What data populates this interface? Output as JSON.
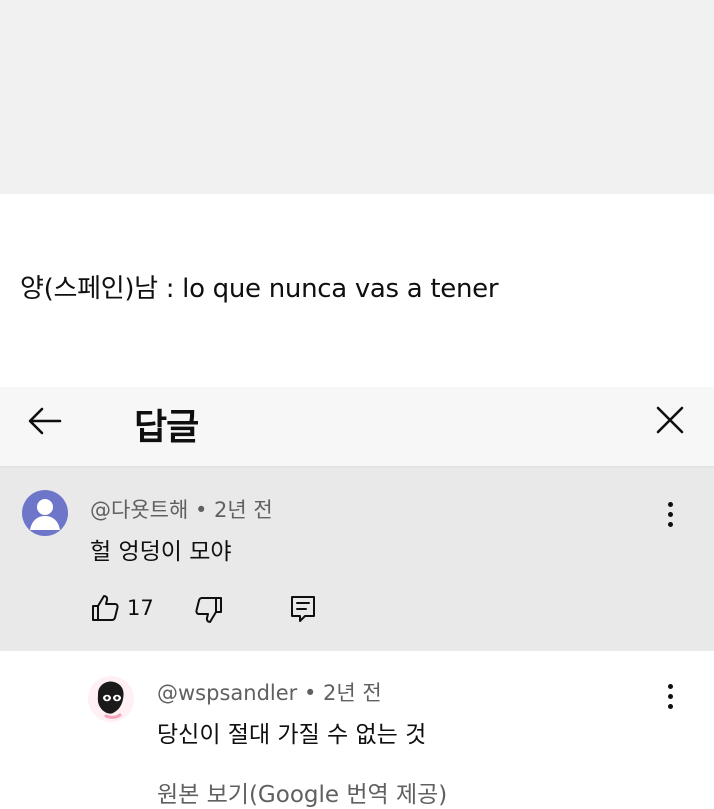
{
  "caption": "양(스페인)남 : lo que nunca vas a tener",
  "header": {
    "title": "답글",
    "back_icon": "arrow-left-icon",
    "close_icon": "close-icon"
  },
  "comments": [
    {
      "author": "@다욧트해",
      "time": "2년 전",
      "text": "헐 엉덩이 모야",
      "likes": "17",
      "avatar_color": "#6e76c9"
    },
    {
      "author": "@wspsandler",
      "time": "2년 전",
      "text": "당신이 절대 가질 수 없는 것",
      "translate_label": "원본 보기(Google 번역 제공)"
    }
  ],
  "colors": {
    "top_band": "#f1f1f1",
    "header_bg": "#f7f7f7",
    "highlight_bg": "#e9e9e9",
    "meta_text": "#606060"
  }
}
